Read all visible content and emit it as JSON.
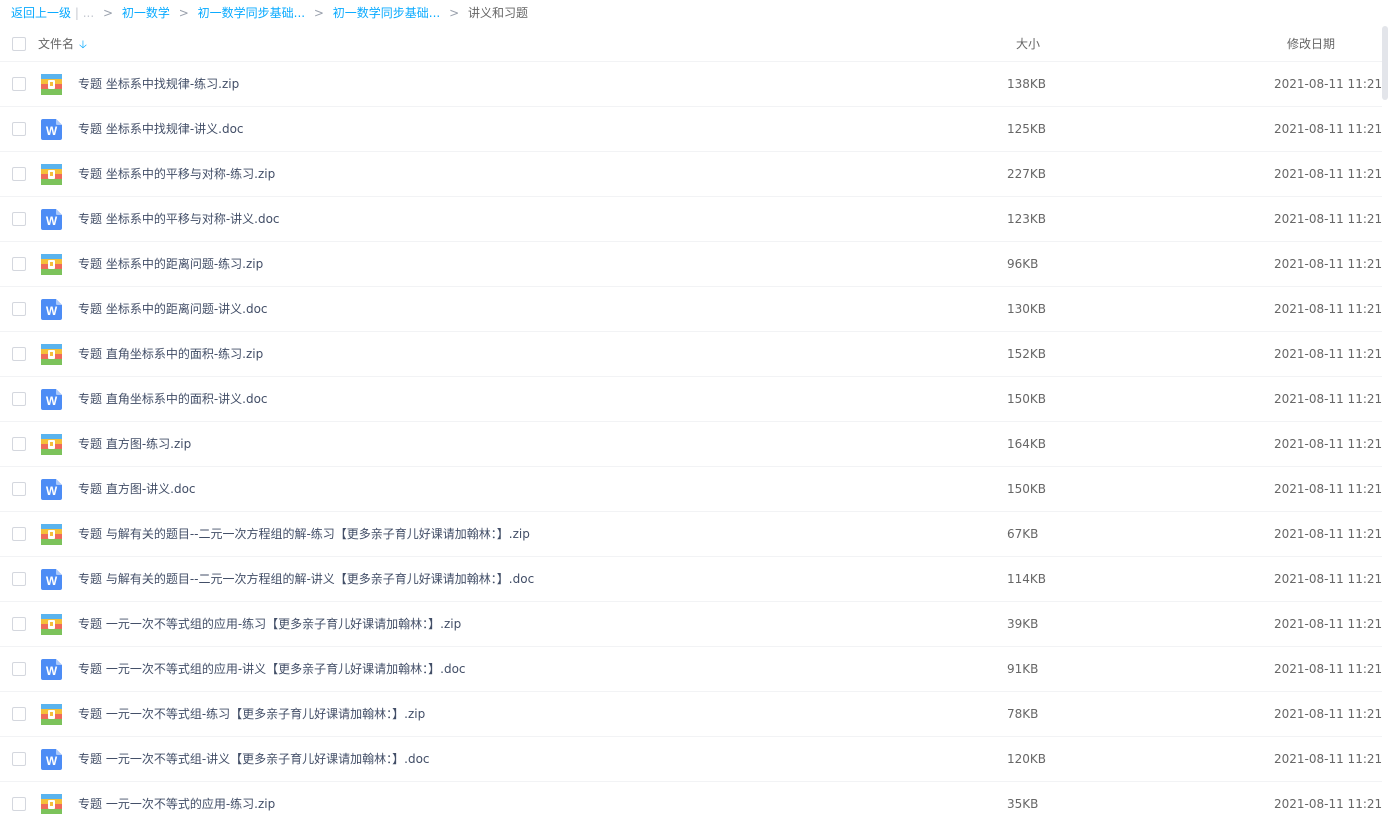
{
  "breadcrumb": {
    "back": "返回上一级",
    "divider": "|",
    "ellipsis": "...",
    "items": [
      "初一数学",
      "初一数学同步基础...",
      "初一数学同步基础..."
    ],
    "current": "讲义和习题"
  },
  "header": {
    "name": "文件名",
    "size": "大小",
    "date": "修改日期"
  },
  "files": [
    {
      "name": "专题 坐标系中找规律-练习.zip",
      "type": "zip",
      "size": "138KB",
      "date": "2021-08-11 11:21"
    },
    {
      "name": "专题 坐标系中找规律-讲义.doc",
      "type": "doc",
      "size": "125KB",
      "date": "2021-08-11 11:21"
    },
    {
      "name": "专题 坐标系中的平移与对称-练习.zip",
      "type": "zip",
      "size": "227KB",
      "date": "2021-08-11 11:21"
    },
    {
      "name": "专题 坐标系中的平移与对称-讲义.doc",
      "type": "doc",
      "size": "123KB",
      "date": "2021-08-11 11:21"
    },
    {
      "name": "专题 坐标系中的距离问题-练习.zip",
      "type": "zip",
      "size": "96KB",
      "date": "2021-08-11 11:21"
    },
    {
      "name": "专题 坐标系中的距离问题-讲义.doc",
      "type": "doc",
      "size": "130KB",
      "date": "2021-08-11 11:21"
    },
    {
      "name": "专题 直角坐标系中的面积-练习.zip",
      "type": "zip",
      "size": "152KB",
      "date": "2021-08-11 11:21"
    },
    {
      "name": "专题 直角坐标系中的面积-讲义.doc",
      "type": "doc",
      "size": "150KB",
      "date": "2021-08-11 11:21"
    },
    {
      "name": "专题 直方图-练习.zip",
      "type": "zip",
      "size": "164KB",
      "date": "2021-08-11 11:21"
    },
    {
      "name": "专题 直方图-讲义.doc",
      "type": "doc",
      "size": "150KB",
      "date": "2021-08-11 11:21"
    },
    {
      "name": "专题 与解有关的题目--二元一次方程组的解-练习【更多亲子育儿好课请加翰林：】.zip",
      "type": "zip",
      "size": "67KB",
      "date": "2021-08-11 11:21"
    },
    {
      "name": "专题 与解有关的题目--二元一次方程组的解-讲义【更多亲子育儿好课请加翰林：】.doc",
      "type": "doc",
      "size": "114KB",
      "date": "2021-08-11 11:21"
    },
    {
      "name": "专题 一元一次不等式组的应用-练习【更多亲子育儿好课请加翰林：】.zip",
      "type": "zip",
      "size": "39KB",
      "date": "2021-08-11 11:21"
    },
    {
      "name": "专题 一元一次不等式组的应用-讲义【更多亲子育儿好课请加翰林：】.doc",
      "type": "doc",
      "size": "91KB",
      "date": "2021-08-11 11:21"
    },
    {
      "name": "专题 一元一次不等式组-练习【更多亲子育儿好课请加翰林：】.zip",
      "type": "zip",
      "size": "78KB",
      "date": "2021-08-11 11:21"
    },
    {
      "name": "专题 一元一次不等式组-讲义【更多亲子育儿好课请加翰林：】.doc",
      "type": "doc",
      "size": "120KB",
      "date": "2021-08-11 11:21"
    },
    {
      "name": "专题 一元一次不等式的应用-练习.zip",
      "type": "zip",
      "size": "35KB",
      "date": "2021-08-11 11:21"
    }
  ],
  "colors": {
    "accent": "#09aaff",
    "doc_icon": "#4d8cf5"
  },
  "icons": {
    "zip": "zip-archive-icon",
    "doc": "word-doc-icon",
    "sort": "sort-down-arrow-icon"
  }
}
